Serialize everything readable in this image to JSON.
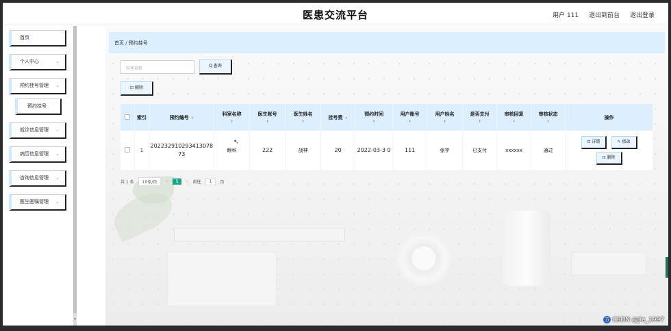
{
  "header": {
    "title": "医患交流平台",
    "user_label": "用户 111",
    "back_label": "退出到前台",
    "logout_label": "退出登录"
  },
  "sidebar": {
    "items": [
      {
        "label": "首页",
        "chevron": ""
      },
      {
        "label": "个人中心",
        "chevron": "⌄"
      },
      {
        "label": "预约挂号管理",
        "chevron": "⌄"
      },
      {
        "label": "预约挂号",
        "chevron": ""
      },
      {
        "label": "就诊信息管理",
        "chevron": "⌄"
      },
      {
        "label": "病历信息管理",
        "chevron": "⌄"
      },
      {
        "label": "咨询信息管理",
        "chevron": "⌄"
      },
      {
        "label": "医生医嘱管理",
        "chevron": "⌄"
      }
    ]
  },
  "breadcrumb": {
    "text": "首页 / 预约挂号"
  },
  "search": {
    "placeholder": "科室名称",
    "query_label": "Q 查询",
    "delete_label": "⊡ 删除"
  },
  "table": {
    "headers": [
      "索引",
      "预约编号",
      "科室名称",
      "医生账号",
      "医生姓名",
      "挂号费",
      "预约时间",
      "用户账号",
      "用户姓名",
      "是否支付",
      "审核回复",
      "审核状态",
      "操作"
    ],
    "sort_mark": "⬍",
    "rows": [
      {
        "index": "1",
        "appointment_no": "202232910293413078 73",
        "department": "眼科",
        "doctor_account": "222",
        "doctor_name": "战神",
        "fee": "20",
        "time": "2022-03-3 0",
        "user_account": "111",
        "user_name": "张宇",
        "paid": "已支付",
        "review_reply": "xxxxxx",
        "review_status": "通过"
      }
    ],
    "ops": {
      "detail": "⊡ 详情",
      "edit": "✎ 修改",
      "delete": "⊡ 删除"
    }
  },
  "pagination": {
    "total": "共 1 条",
    "page_size": "10条/页",
    "prev": "<",
    "current": "1",
    "next": ">",
    "goto_label": "前往",
    "goto_value": "1",
    "page_suffix": "页"
  },
  "watermark": {
    "logo": "五",
    "text": "CSDN @Jie_1997"
  }
}
